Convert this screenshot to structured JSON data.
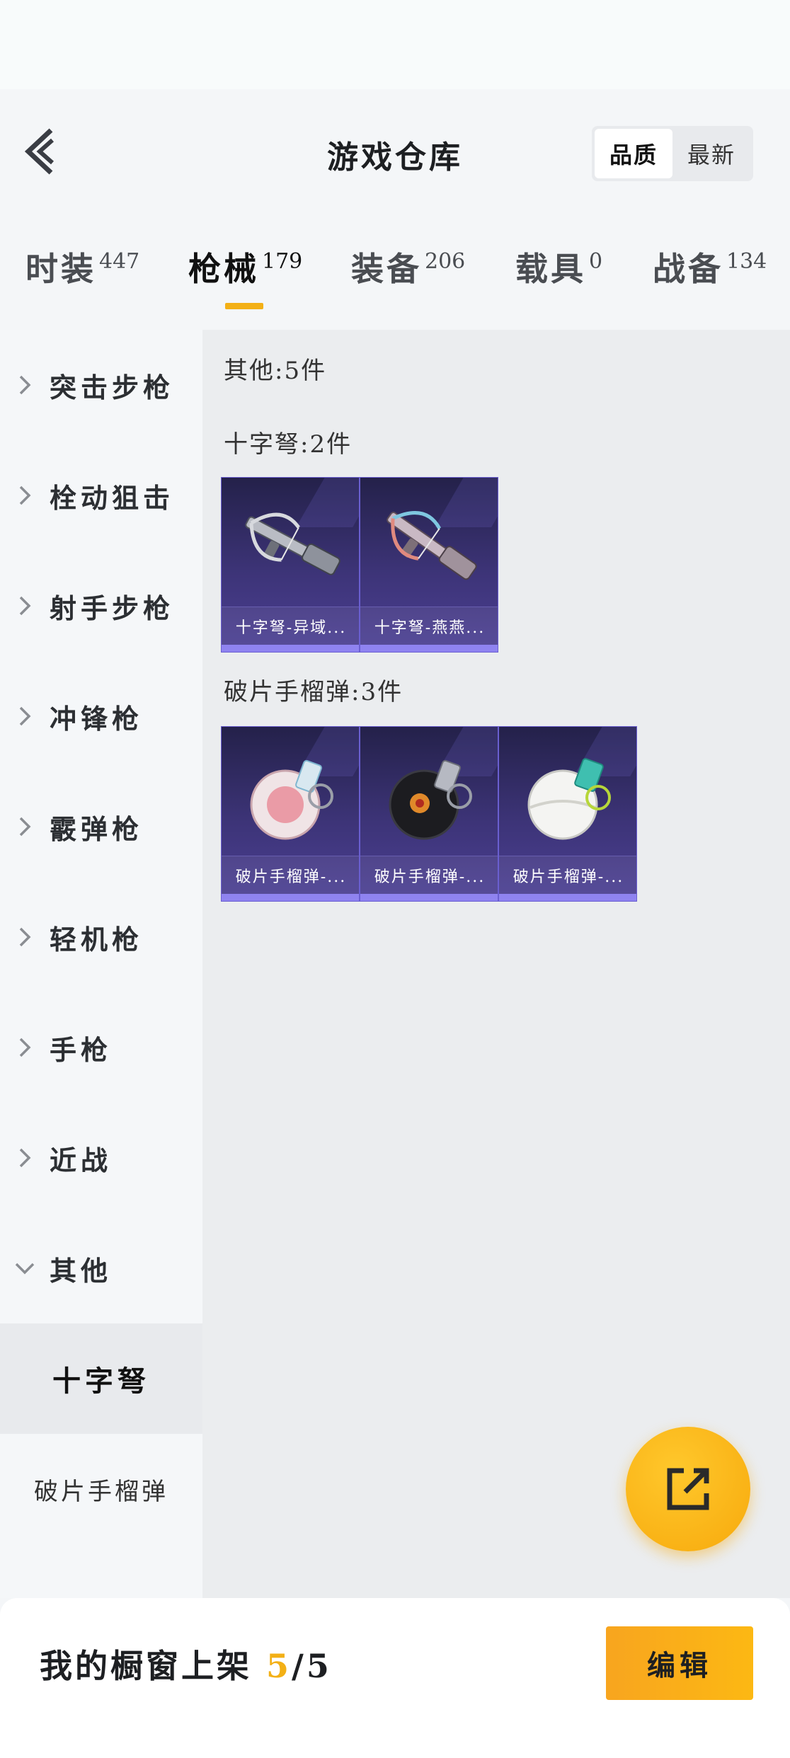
{
  "header": {
    "title": "游戏仓库",
    "sort_options": [
      "品质",
      "最新"
    ],
    "sort_selected": "品质"
  },
  "tabs": [
    {
      "label": "时装",
      "count": "447"
    },
    {
      "label": "枪械",
      "count": "179",
      "active": true
    },
    {
      "label": "装备",
      "count": "206"
    },
    {
      "label": "载具",
      "count": "0"
    },
    {
      "label": "战备",
      "count": "134"
    }
  ],
  "sidebar": {
    "categories": [
      "突击步枪",
      "栓动狙击",
      "射手步枪",
      "冲锋枪",
      "霰弹枪",
      "轻机枪",
      "手枪",
      "近战",
      "其他"
    ],
    "expanded": "其他",
    "subcategories": [
      "十字弩",
      "破片手榴弹"
    ],
    "selected_sub": "十字弩"
  },
  "content": {
    "summary": "其他:5件",
    "groups": [
      {
        "title": "十字弩:2件",
        "items": [
          {
            "name": "十字弩-异域...",
            "icon": "crossbow-icon"
          },
          {
            "name": "十字弩-燕燕...",
            "icon": "crossbow-icon"
          }
        ]
      },
      {
        "title": "破片手榴弹:3件",
        "items": [
          {
            "name": "破片手榴弹-...",
            "icon": "grenade-icon"
          },
          {
            "name": "破片手榴弹-...",
            "icon": "grenade-icon"
          },
          {
            "name": "破片手榴弹-...",
            "icon": "grenade-icon"
          }
        ]
      }
    ]
  },
  "bottom": {
    "shelf_label": "我的橱窗上架",
    "shelf_current": "5",
    "shelf_total": "/5",
    "edit_label": "编辑"
  },
  "colors": {
    "accent": "#f3b016",
    "card_bg": "#3d3478",
    "card_bar": "#8f83f0"
  }
}
